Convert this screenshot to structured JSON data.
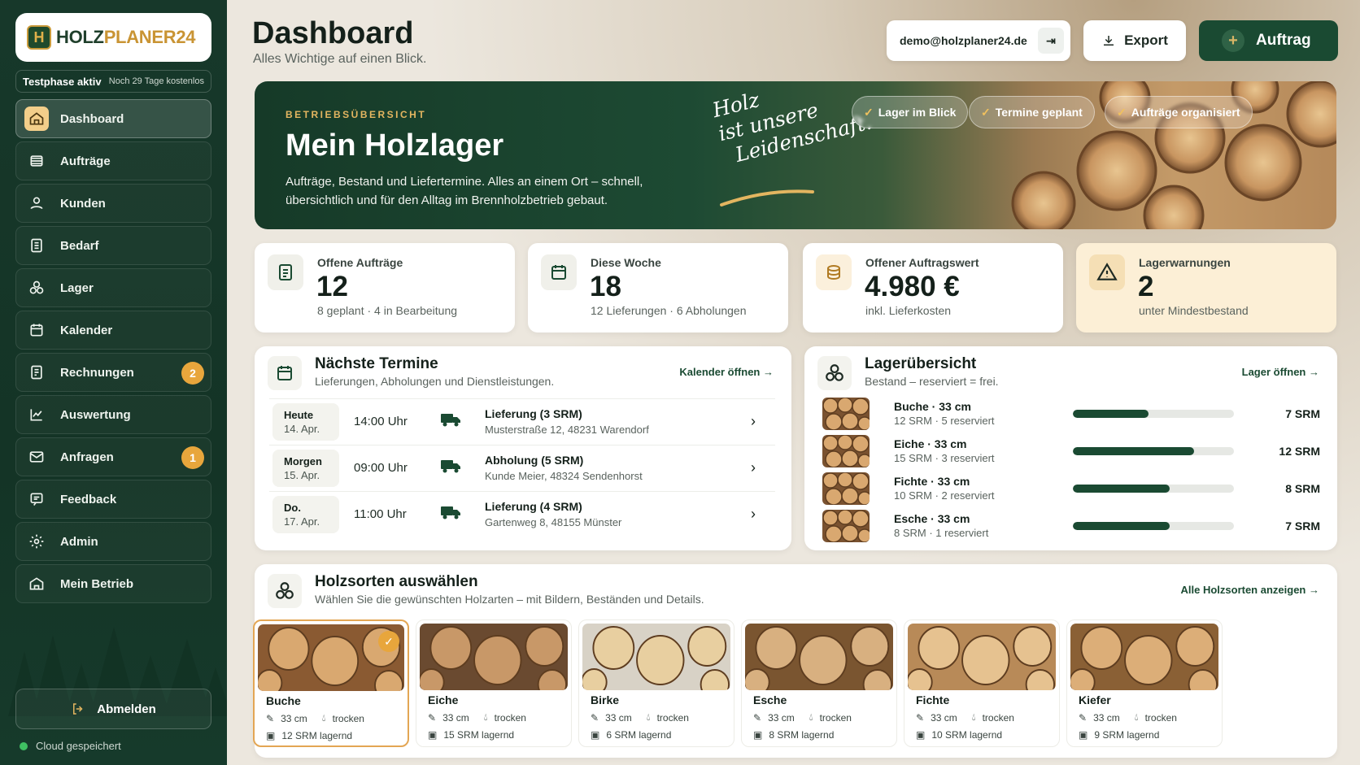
{
  "brand": {
    "logo_main": "HOLZ",
    "logo_accent": "PLANER24"
  },
  "trial": {
    "status": "Testphase aktiv",
    "remaining": "Noch 29 Tage kostenlos"
  },
  "sidebar": {
    "items": [
      {
        "label": "Dashboard",
        "icon": "home-icon",
        "active": true
      },
      {
        "label": "Aufträge",
        "icon": "stack-icon"
      },
      {
        "label": "Kunden",
        "icon": "user-icon"
      },
      {
        "label": "Bedarf",
        "icon": "document-icon"
      },
      {
        "label": "Lager",
        "icon": "logs-icon"
      },
      {
        "label": "Kalender",
        "icon": "calendar-icon"
      },
      {
        "label": "Rechnungen",
        "icon": "invoice-icon",
        "badge": "2"
      },
      {
        "label": "Auswertung",
        "icon": "chart-icon"
      },
      {
        "label": "Anfragen",
        "icon": "mail-icon",
        "badge": "1"
      },
      {
        "label": "Feedback",
        "icon": "chat-icon"
      },
      {
        "label": "Admin",
        "icon": "gear-icon"
      },
      {
        "label": "Mein Betrieb",
        "icon": "building-icon"
      }
    ],
    "logout": "Abmelden",
    "cloud_status": "Cloud gespeichert"
  },
  "header": {
    "title": "Dashboard",
    "subtitle": "Alles Wichtige auf einen Blick.",
    "email": "demo@holzplaner24.de",
    "export": "Export",
    "add": "Auftrag"
  },
  "hero": {
    "kicker": "BETRIEBSÜBERSICHT",
    "title": "Mein Holzlager",
    "text": "Aufträge, Bestand und Liefertermine. Alles an einem Ort – schnell, übersichtlich und für den Alltag im Brennholzbetrieb gebaut.",
    "script": [
      "Holz",
      "ist unsere",
      "Leidenschaft."
    ],
    "chips": [
      "Lager im Blick",
      "Termine geplant",
      "Aufträge organisiert"
    ]
  },
  "stats": [
    {
      "label": "Offene Aufträge",
      "value": "12",
      "sub": "8 geplant · 4 in Bearbeitung",
      "icon": "clipboard-icon"
    },
    {
      "label": "Diese Woche",
      "value": "18",
      "sub": "12 Lieferungen · 6 Abholungen",
      "icon": "calendar-icon"
    },
    {
      "label": "Offener Auftragswert",
      "value": "4.980 €",
      "sub": "inkl. Lieferkosten",
      "icon": "coins-icon"
    },
    {
      "label": "Lagerwarnungen",
      "value": "2",
      "sub": "unter Mindestbestand",
      "icon": "warning-icon"
    }
  ],
  "appointments": {
    "title": "Nächste Termine",
    "subtitle": "Lieferungen, Abholungen und Dienstleistungen.",
    "link": "Kalender öffnen",
    "items": [
      {
        "day": "Heute",
        "date": "14. Apr.",
        "time": "14:00 Uhr",
        "title": "Lieferung (3 SRM)",
        "address": "Musterstraße 12, 48231 Warendorf"
      },
      {
        "day": "Morgen",
        "date": "15. Apr.",
        "time": "09:00 Uhr",
        "title": "Abholung (5 SRM)",
        "address": "Kunde Meier, 48324 Sendenhorst"
      },
      {
        "day": "Do.",
        "date": "17. Apr.",
        "time": "11:00 Uhr",
        "title": "Lieferung (4 SRM)",
        "address": "Gartenweg 8, 48155 Münster"
      }
    ]
  },
  "stock": {
    "title": "Lagerübersicht",
    "subtitle": "Bestand – reserviert = frei.",
    "link": "Lager öffnen",
    "items": [
      {
        "name": "Buche · 33 cm",
        "detail": "12 SRM · 5 reserviert",
        "qty": "7 SRM",
        "fill": 0.47
      },
      {
        "name": "Eiche · 33 cm",
        "detail": "15 SRM · 3 reserviert",
        "qty": "12 SRM",
        "fill": 0.75
      },
      {
        "name": "Fichte · 33 cm",
        "detail": "10 SRM · 2 reserviert",
        "qty": "8 SRM",
        "fill": 0.6
      },
      {
        "name": "Esche · 33 cm",
        "detail": "8 SRM · 1 reserviert",
        "qty": "7 SRM",
        "fill": 0.6
      }
    ]
  },
  "woods": {
    "title": "Holzsorten auswählen",
    "subtitle": "Wählen Sie die gewünschten Holzarten – mit Bildern, Beständen und Details.",
    "link": "Alle Holzsorten anzeigen",
    "items": [
      {
        "name": "Buche",
        "length": "33 cm",
        "state": "trocken",
        "stock": "12 SRM lagernd",
        "selected": true
      },
      {
        "name": "Eiche",
        "length": "33 cm",
        "state": "trocken",
        "stock": "15 SRM lagernd"
      },
      {
        "name": "Birke",
        "length": "33 cm",
        "state": "trocken",
        "stock": "6 SRM lagernd"
      },
      {
        "name": "Esche",
        "length": "33 cm",
        "state": "trocken",
        "stock": "8 SRM lagernd"
      },
      {
        "name": "Fichte",
        "length": "33 cm",
        "state": "trocken",
        "stock": "10 SRM lagernd"
      },
      {
        "name": "Kiefer",
        "length": "33 cm",
        "state": "trocken",
        "stock": "9 SRM lagernd"
      }
    ]
  },
  "colors": {
    "primary": "#1a4a32",
    "accent": "#e8a63c",
    "sidebar": "#17382a"
  }
}
